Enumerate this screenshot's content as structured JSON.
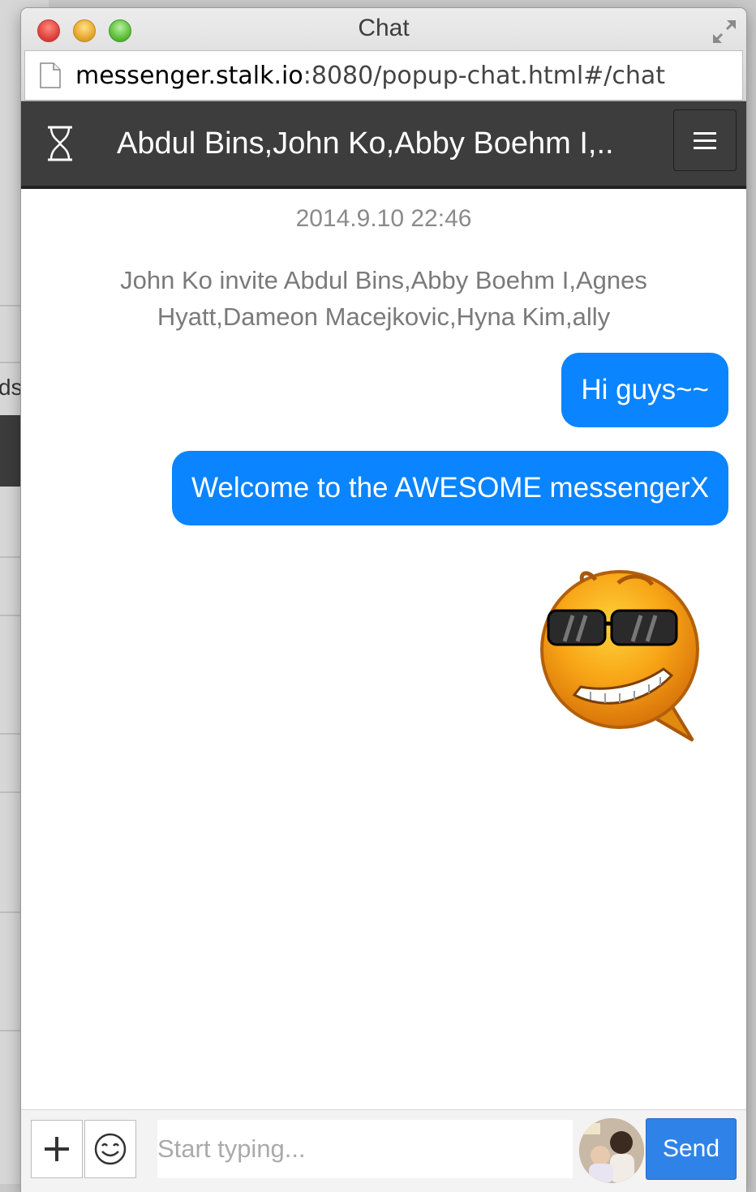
{
  "background": {
    "partial_text": "ds"
  },
  "window": {
    "title": "Chat",
    "url_host": "messenger.stalk.io",
    "url_rest": ":8080/popup-chat.html#/chat"
  },
  "navbar": {
    "room_title": "Abdul Bins,John Ko,Abby Boehm I,...",
    "left_icon": "hourglass-icon",
    "menu_icon": "hamburger-menu-icon"
  },
  "chat": {
    "date": "2014.9.10 22:46",
    "system_message": "John Ko invite Abdul Bins,Abby Boehm I,Agnes Hyatt,Dameon Macejkovic,Hyna Kim,ally",
    "messages": [
      {
        "text": "Hi guys~~"
      },
      {
        "text": "Welcome to the AWESOME messengerX"
      }
    ],
    "sticker": "sunglasses-grin-emoticon"
  },
  "input": {
    "placeholder": "Start typing...",
    "value": "",
    "send_label": "Send",
    "add_icon": "plus-icon",
    "emoji_icon": "smiley-icon"
  },
  "colors": {
    "bubble": "#0a84ff",
    "navbar": "#3d3d3d",
    "send_button": "#2f83e8"
  }
}
